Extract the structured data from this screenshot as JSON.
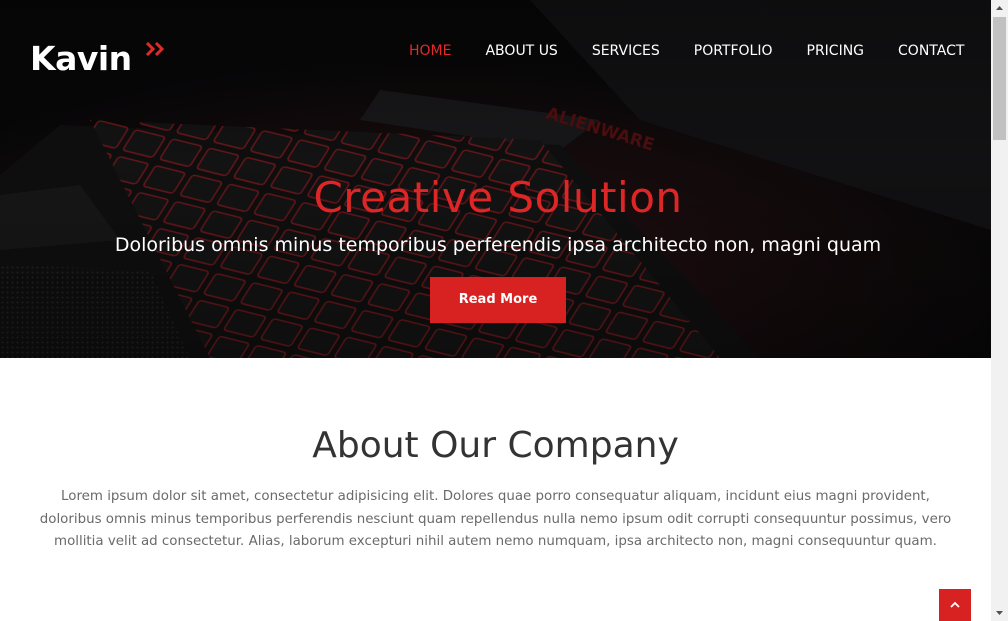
{
  "brand": {
    "name": "Kavin",
    "accent": "#d82222",
    "logo_mark": "double-chevron-icon"
  },
  "nav": {
    "items": [
      {
        "label": "HOME",
        "active": true
      },
      {
        "label": "ABOUT US",
        "active": false
      },
      {
        "label": "SERVICES",
        "active": false
      },
      {
        "label": "PORTFOLIO",
        "active": false
      },
      {
        "label": "PRICING",
        "active": false
      },
      {
        "label": "CONTACT",
        "active": false
      }
    ]
  },
  "hero": {
    "title": "Creative Solution",
    "subtitle": "Doloribus omnis minus temporibus perferendis ipsa architecto non, magni quam",
    "button_label": "Read More",
    "background": "laptop-keyboard-photo",
    "laptop_brand_text": "ALIENWARE"
  },
  "about": {
    "title": "About Our Company",
    "text": "Lorem ipsum dolor sit amet, consectetur adipisicing elit. Dolores quae porro consequatur aliquam, incidunt eius magni provident, doloribus omnis minus temporibus perferendis nesciunt quam repellendus nulla nemo ipsum odit corrupti consequuntur possimus, vero mollitia velit ad consectetur. Alias, laborum excepturi nihil autem nemo numquam, ipsa architecto non, magni consequuntur quam."
  },
  "back_to_top": {
    "icon": "chevron-up-icon"
  },
  "scrollbar": {
    "up_icon": "scroll-up-arrow-icon",
    "down_icon": "scroll-down-arrow-icon"
  }
}
